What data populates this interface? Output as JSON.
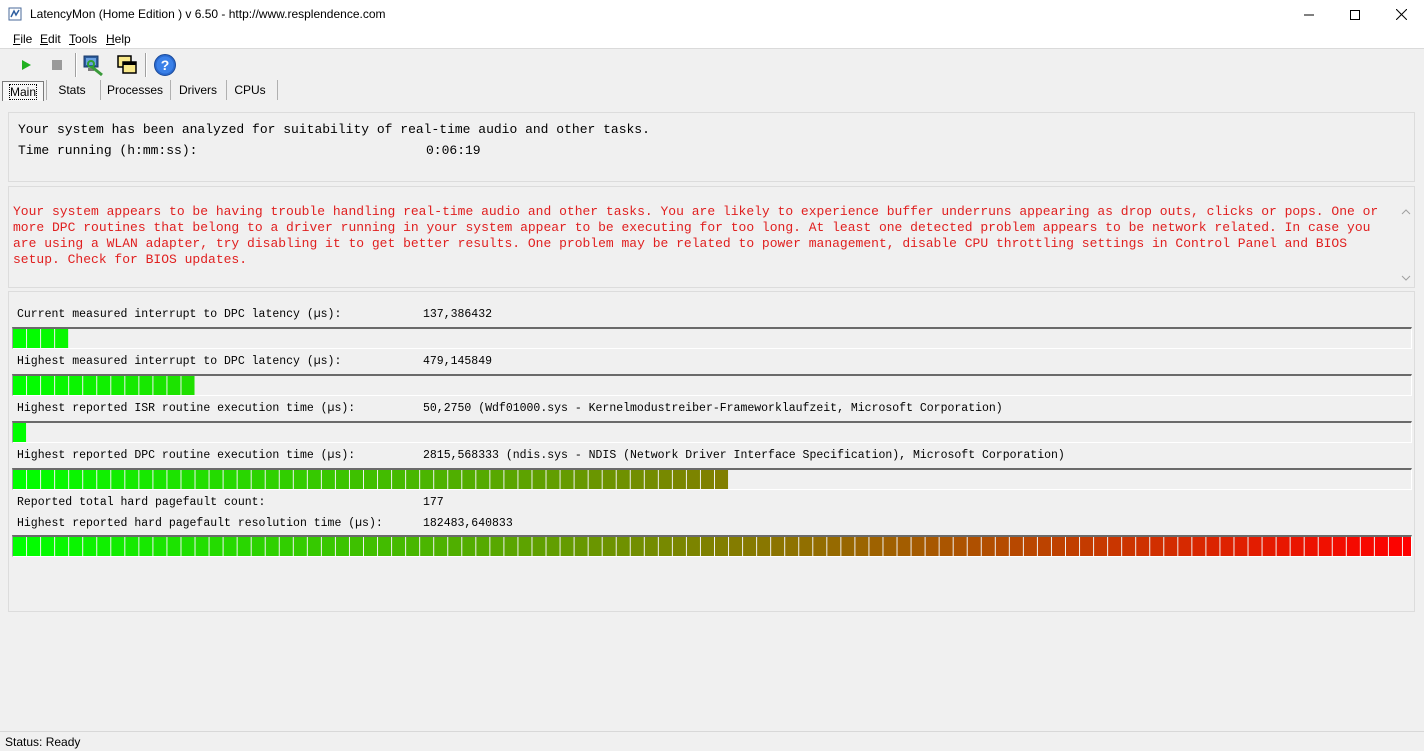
{
  "window": {
    "title": "LatencyMon  (Home Edition )  v 6.50 - http://www.resplendence.com"
  },
  "menu": [
    {
      "label": "File",
      "accel": "F",
      "rest": "ile"
    },
    {
      "label": "Edit",
      "accel": "E",
      "rest": "dit"
    },
    {
      "label": "Tools",
      "accel": "T",
      "rest": "ools"
    },
    {
      "label": "Help",
      "accel": "H",
      "rest": "elp"
    }
  ],
  "toolbar": {
    "icons": [
      "play-icon",
      "stop-icon",
      "analyze-tools-icon",
      "windows-cascade-icon",
      "help-icon"
    ]
  },
  "tabs": [
    {
      "label": "Main",
      "active": true
    },
    {
      "label": "Stats",
      "active": false
    },
    {
      "label": "Processes",
      "active": false
    },
    {
      "label": "Drivers",
      "active": false
    },
    {
      "label": "CPUs",
      "active": false
    }
  ],
  "summary": {
    "analyzed_text": "Your system has been analyzed for suitability of real-time audio and other tasks.",
    "time_label": "Time running (h:mm:ss):",
    "time_value": "0:06:19"
  },
  "warning": {
    "text": "Your system appears to be having trouble handling real-time audio and other tasks. You are likely to experience buffer underruns appearing as drop outs, clicks or pops. One or more DPC routines that belong to a driver running in your system appear to be executing for too long. At least one detected problem appears to be network related. In case you are using a WLAN adapter, try disabling it to get better results. One problem may be related to power management, disable CPU throttling settings in Control Panel and BIOS setup. Check for BIOS updates.",
    "color": "#e02020"
  },
  "metrics": {
    "current_dpc": {
      "label": "Current measured interrupt to DPC latency (µs):",
      "value": "137,386432",
      "level": 0.035
    },
    "highest_dpc": {
      "label": "Highest measured interrupt to DPC latency (µs):",
      "value": "479,145849",
      "level": 0.132
    },
    "highest_isr": {
      "label": "Highest reported ISR routine execution time (µs):",
      "value": "50,2750  (Wdf01000.sys - Kernelmodustreiber-Frameworklaufzeit, Microsoft Corporation)",
      "level": 0.011
    },
    "highest_dpc_routine": {
      "label": "Highest reported DPC routine execution time (µs):",
      "value": "2815,568333  (ndis.sys - NDIS (Network Driver Interface Specification), Microsoft Corporation)",
      "level": 0.51
    },
    "pagefault_count": {
      "label": "Reported total hard pagefault count:",
      "value": "177"
    },
    "pagefault_time": {
      "label": "Highest reported hard pagefault resolution time (µs):",
      "value": "182483,640833",
      "level": 1.0
    }
  },
  "status": {
    "text": "Status: Ready"
  },
  "colors": {
    "bar_start": "#00ff00",
    "bar_end": "#ff0000",
    "bar_dim_start": "#10d010"
  }
}
